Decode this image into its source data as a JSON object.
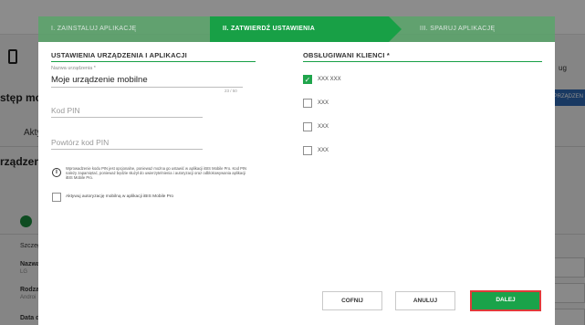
{
  "background": {
    "heading_partial": "stęp mo",
    "tab_partial": "Akty",
    "section_partial": "rządzen",
    "right_text": "ug",
    "right_button": "ZPRZĄDZEN",
    "rows": [
      {
        "label": "Szczeg",
        "value": ""
      },
      {
        "label": "Nazwa",
        "value": "LG"
      },
      {
        "label": "Rodzaj",
        "value": "Androi"
      },
      {
        "label": "Data d",
        "value": ""
      }
    ]
  },
  "stepper": {
    "steps": [
      {
        "label": "I. ZAINSTALUJ APLIKACJĘ",
        "state": "done"
      },
      {
        "label": "II. ZATWIERDŹ USTAWIENIA",
        "state": "active"
      },
      {
        "label": "III. SPARUJ APLIKACJĘ",
        "state": "pending"
      }
    ]
  },
  "left_section": {
    "title": "USTAWIENIA URZĄDZENIA I APLIKACJI",
    "device_name_label": "Nazwa urządzenia *",
    "device_name_value": "Moje urządzenie mobilne",
    "device_name_counter": "23 / 50",
    "pin_placeholder": "Kod PIN",
    "pin_repeat_placeholder": "Powtórz kod PIN",
    "info_text": "Wprowadzenie kodu PIN jest opcjonalne, ponieważ można go ustawić w aplikacji iBIS Mobile Pro. Kod PIN należy zapamiętać, ponieważ będzie służył do uwierzytelnienia i autoryzacji oraz odblokowywania aplikacji iBIS Mobile Pro.",
    "biometric_label": "Aktywuj autoryzację mobilną w aplikacji iBIS Mobile Pro"
  },
  "right_section": {
    "title": "OBSŁUGIWANI KLIENCI *",
    "clients": [
      {
        "label": "XXX XXX",
        "checked": true
      },
      {
        "label": "XXX",
        "checked": false
      },
      {
        "label": "XXX",
        "checked": false
      },
      {
        "label": "XXX",
        "checked": false
      }
    ]
  },
  "footer": {
    "back_label": "COFNIJ",
    "cancel_label": "ANULUJ",
    "next_label": "DALEJ"
  },
  "colors": {
    "accent": "#18a046",
    "highlight": "#e03a3a"
  }
}
